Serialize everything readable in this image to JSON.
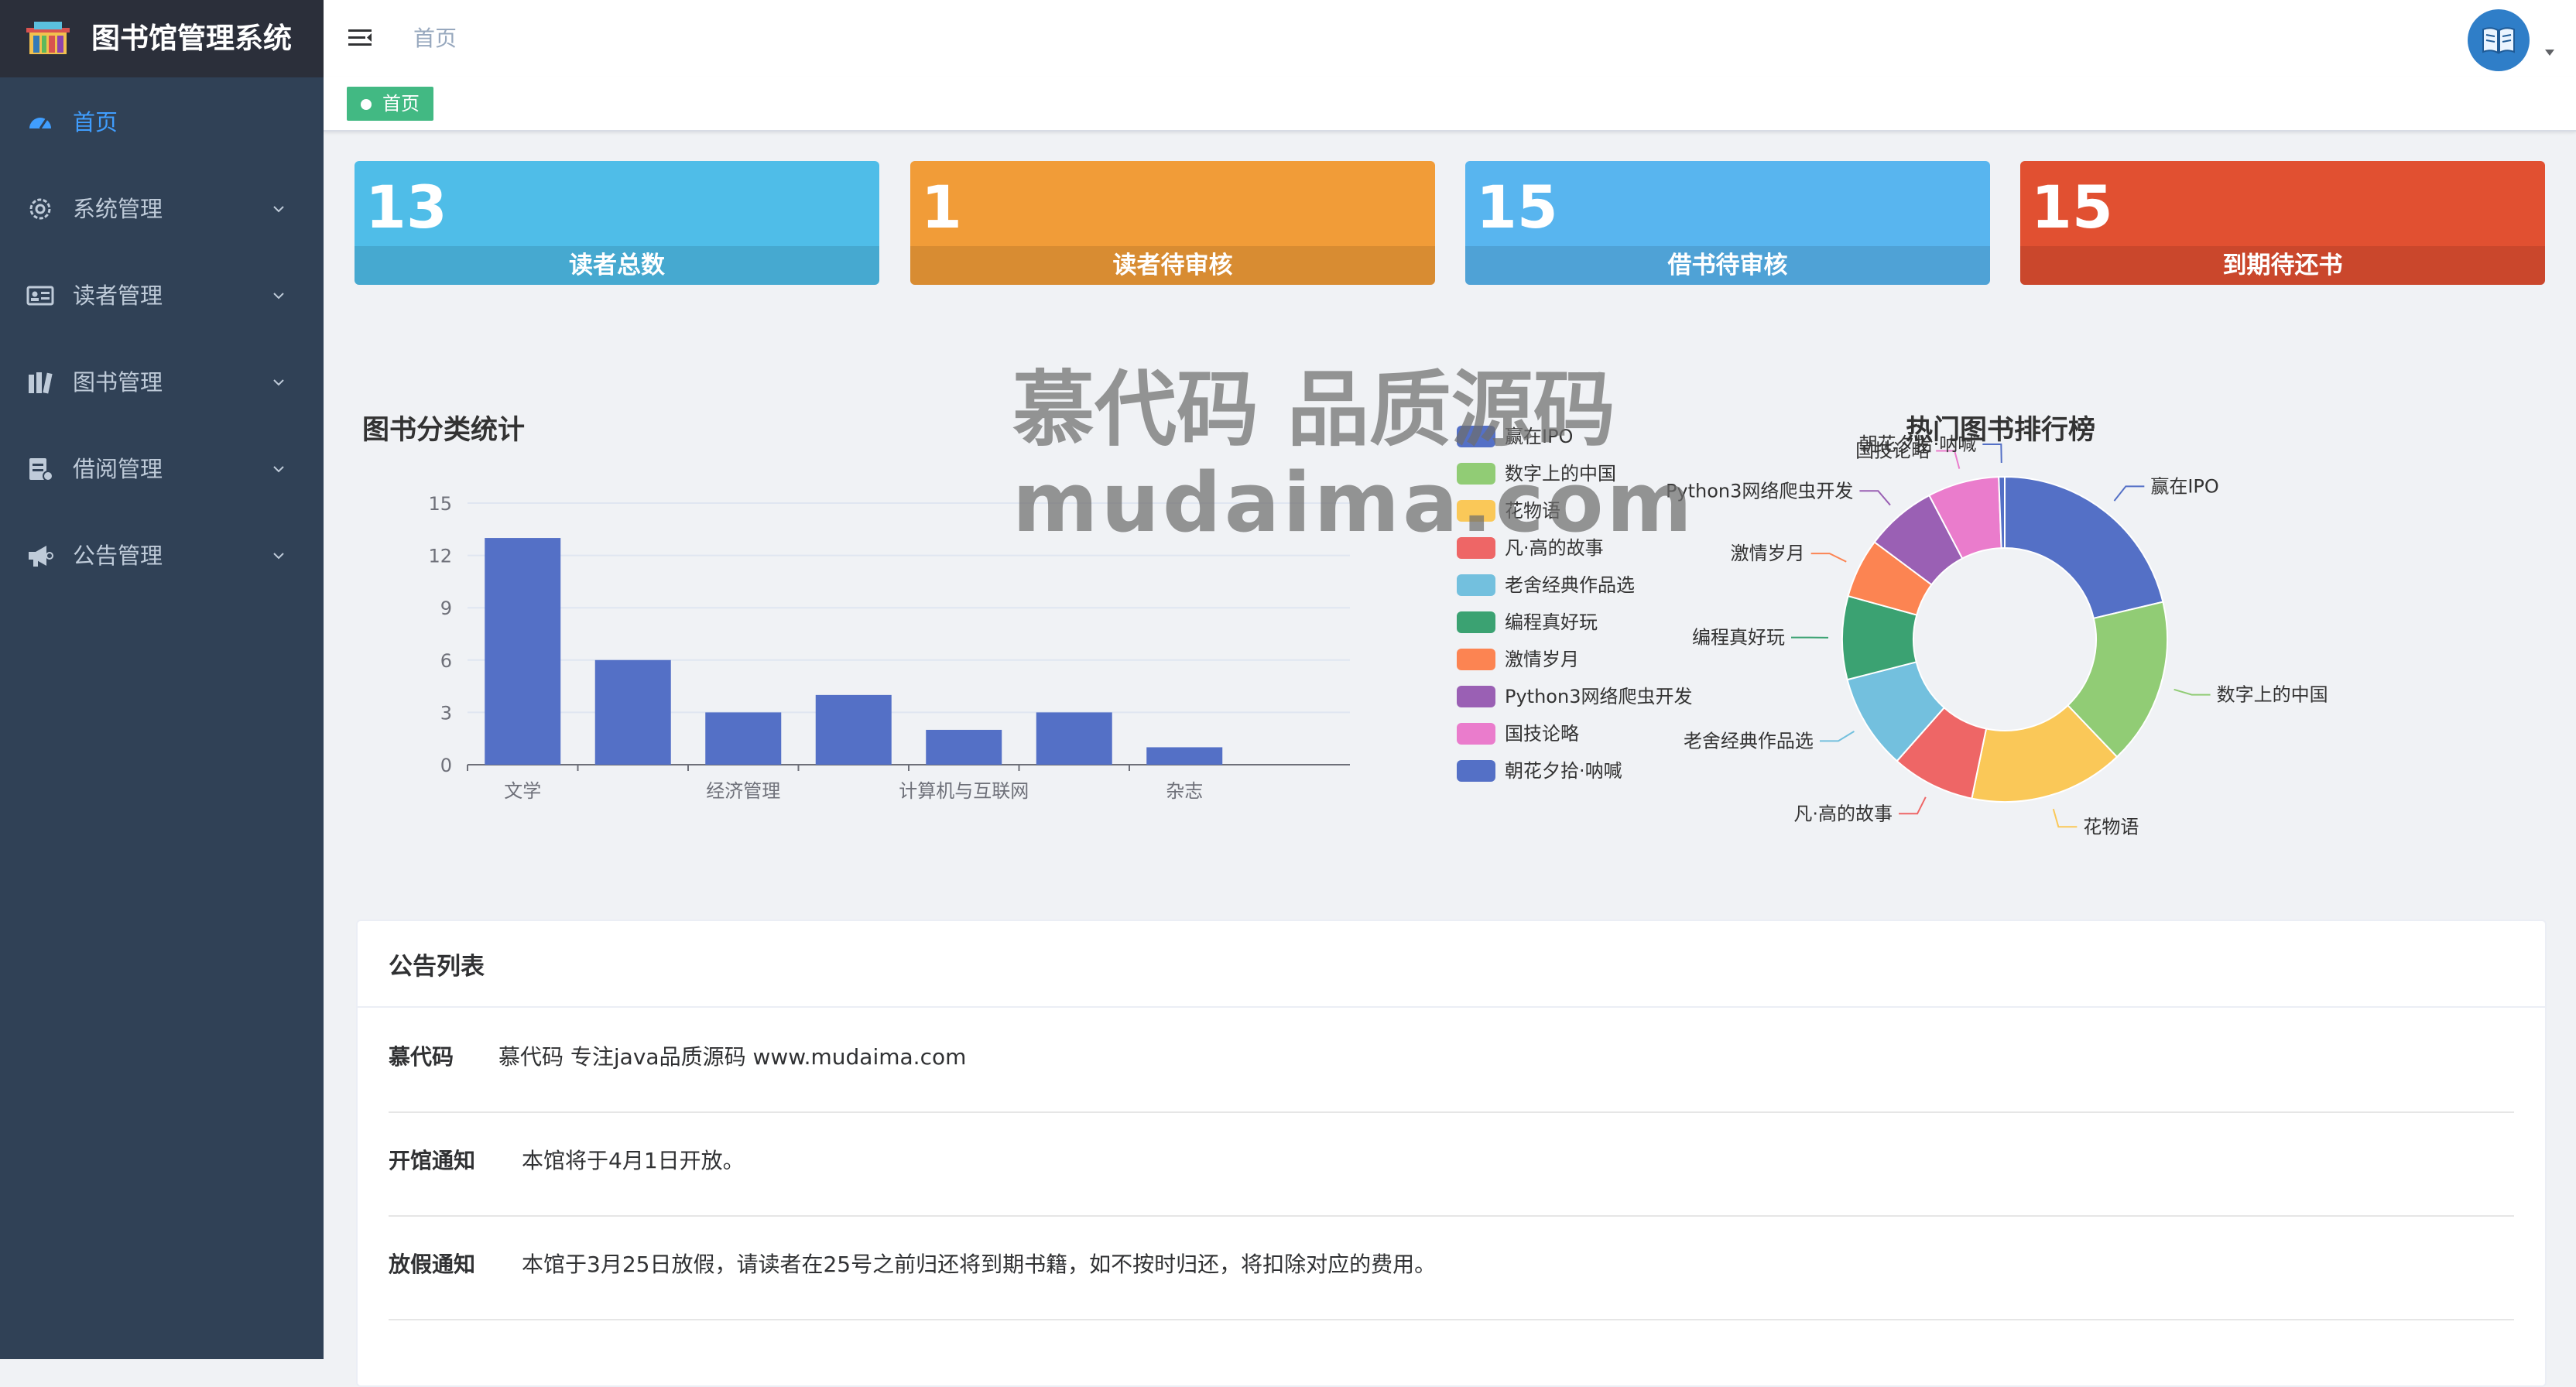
{
  "app": {
    "title": "图书馆管理系统"
  },
  "sidebar": {
    "items": [
      {
        "label": "首页",
        "icon": "dashboard-icon",
        "active": true
      },
      {
        "label": "系统管理",
        "icon": "gear-icon"
      },
      {
        "label": "读者管理",
        "icon": "id-card-icon"
      },
      {
        "label": "图书管理",
        "icon": "books-icon"
      },
      {
        "label": "借阅管理",
        "icon": "clipboard-icon"
      },
      {
        "label": "公告管理",
        "icon": "megaphone-icon"
      }
    ]
  },
  "header": {
    "breadcrumb": "首页",
    "avatar_icon": "book-icon"
  },
  "tags": {
    "home": "首页"
  },
  "stats": [
    {
      "value": "13",
      "label": "读者总数",
      "color": "#4fbde8"
    },
    {
      "value": "1",
      "label": "读者待审核",
      "color": "#f19c38"
    },
    {
      "value": "15",
      "label": "借书待审核",
      "color": "#58b5ef"
    },
    {
      "value": "15",
      "label": "到期待还书",
      "color": "#e15031"
    }
  ],
  "watermark": {
    "line1": "慕代码 品质源码",
    "line2": "mudaima.com"
  },
  "chart_data": [
    {
      "type": "bar",
      "title": "图书分类统计",
      "categories": [
        "文学",
        "",
        "经济管理",
        "",
        "计算机与互联网",
        "",
        "杂志"
      ],
      "values": [
        13,
        6,
        3,
        4,
        2,
        3,
        1
      ],
      "ylim": [
        0,
        15
      ],
      "yticks": [
        "0",
        "3",
        "6",
        "9",
        "12",
        "15"
      ],
      "grid": true,
      "color": "#5470c6"
    },
    {
      "type": "pie",
      "title": "热门图书排行榜",
      "donut": true,
      "legend": "left",
      "labels": [
        "赢在IPO",
        "数字上的中国",
        "花物语",
        "凡·高的故事",
        "老舍经典作品选",
        "编程真好玩",
        "激情岁月",
        "Python3网络爬虫开发",
        "国技论略",
        "朝花夕拾·呐喊"
      ],
      "values": [
        18,
        14,
        13,
        7,
        8,
        7,
        5,
        6,
        6,
        0.5
      ],
      "colors": [
        "#5470c6",
        "#91cc75",
        "#fac858",
        "#ee6666",
        "#73c0de",
        "#3ba272",
        "#fc8452",
        "#9a60b4",
        "#ea7ccc",
        "#5470c6"
      ]
    }
  ],
  "notices": {
    "title": "公告列表",
    "items": [
      {
        "title": "慕代码",
        "body": "慕代码 专注java品质源码 www.mudaima.com"
      },
      {
        "title": "开馆通知",
        "body": "本馆将于4月1日开放。"
      },
      {
        "title": "放假通知",
        "body": "本馆于3月25日放假，请读者在25号之前归还将到期书籍，如不按时归还，将扣除对应的费用。"
      }
    ]
  }
}
